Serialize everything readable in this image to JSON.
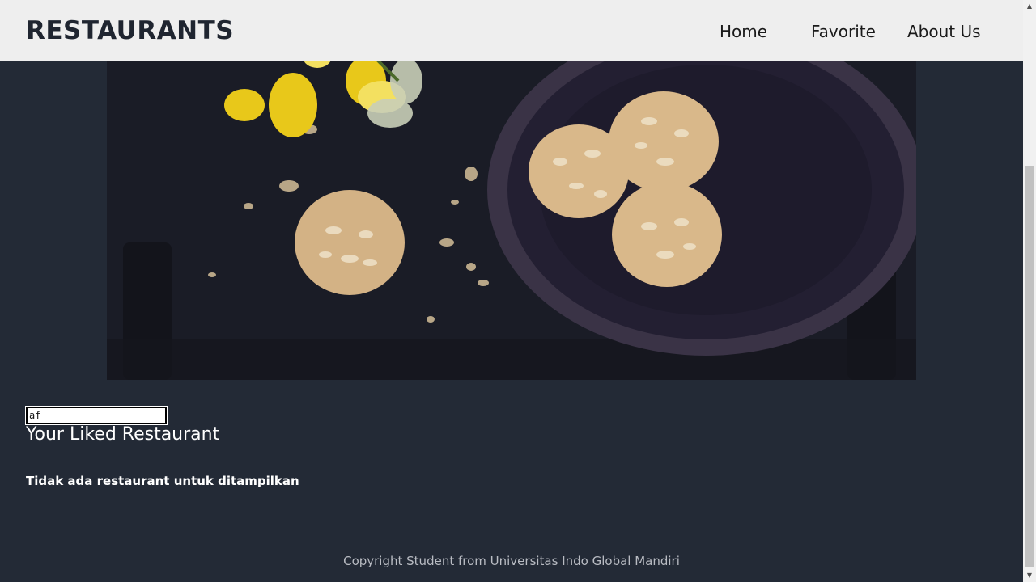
{
  "navbar": {
    "brand": "RESTAURANTS",
    "links": [
      {
        "label": "Home"
      },
      {
        "label": "Favorite"
      },
      {
        "label": "About Us"
      }
    ]
  },
  "hero": {
    "image": "cookies-and-daffodils-photo"
  },
  "search": {
    "value": "af"
  },
  "favorites": {
    "title": "Your Liked Restaurant",
    "empty_message": "Tidak ada restaurant untuk ditampilkan"
  },
  "footer": {
    "text": "Copyright Student from Universitas Indo Global Mandiri"
  },
  "scrollbar": {
    "up_icon": "scroll-up-arrow-icon",
    "down_icon": "scroll-down-arrow-icon",
    "up_glyph": "▲",
    "down_glyph": "▼"
  },
  "colors": {
    "background": "#232a36",
    "navbar": "#eeeeee",
    "text": "#ffffff"
  }
}
